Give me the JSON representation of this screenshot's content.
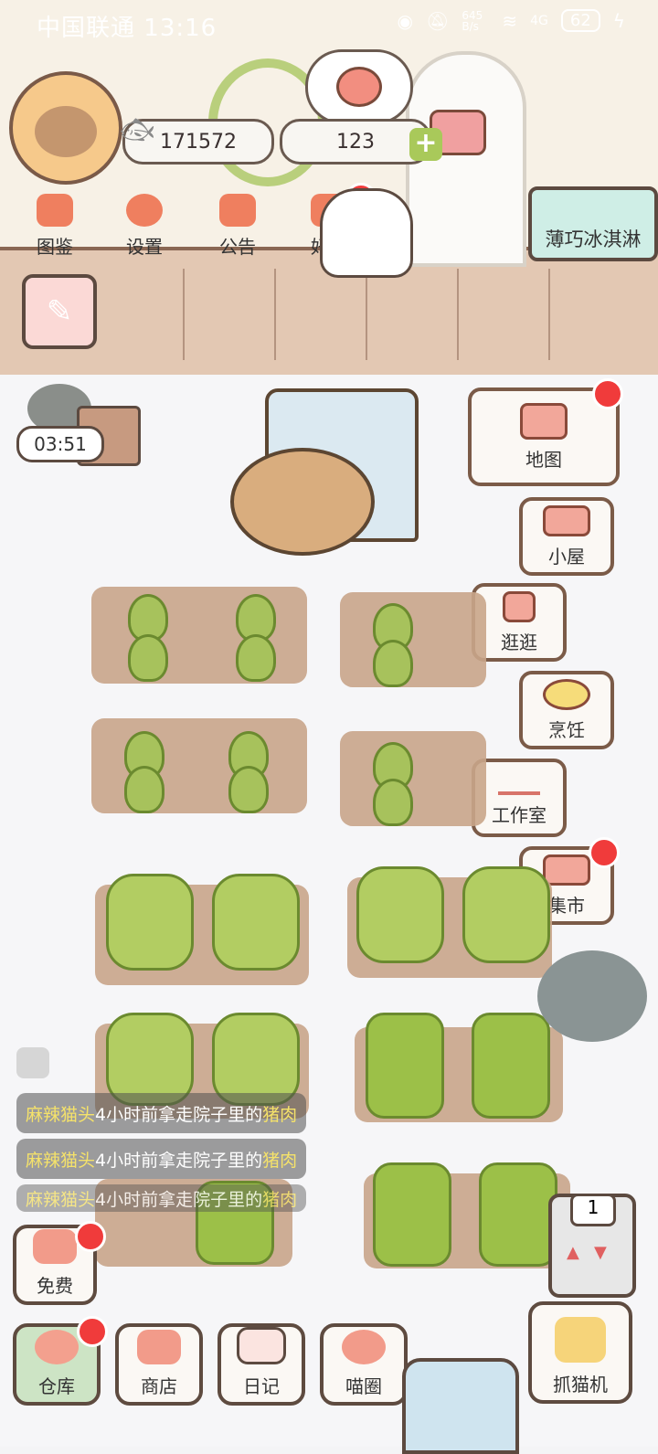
{
  "status_bar": {
    "carrier": "中国联通",
    "time": "13:16",
    "network": "4G",
    "speed": "645 B/s",
    "battery": "62"
  },
  "profile": {
    "coins": "171572",
    "hearts": "123"
  },
  "top_menu": [
    {
      "label": "图鉴"
    },
    {
      "label": "设置"
    },
    {
      "label": "公告"
    },
    {
      "label": "好友"
    }
  ],
  "event_banner": "薄巧冰淇淋",
  "timer": "03:51",
  "side_menu": [
    {
      "label": "地图"
    },
    {
      "label": "小屋"
    },
    {
      "label": "逛逛"
    },
    {
      "label": "烹饪"
    },
    {
      "label": "工作室"
    },
    {
      "label": "集市"
    }
  ],
  "feed": [
    {
      "who": "麻辣猫头",
      "text": "4小时前拿走院子里的",
      "item": "猪肉"
    },
    {
      "who": "麻辣猫头",
      "text": "4小时前拿走院子里的",
      "item": "猪肉"
    },
    {
      "who": "麻辣猫头",
      "text": "4小时前拿走院子里的",
      "item": "猪肉"
    }
  ],
  "free_label": "免费",
  "elevator_floor": "1",
  "bottom_dock": [
    {
      "label": "仓库"
    },
    {
      "label": "商店"
    },
    {
      "label": "日记"
    },
    {
      "label": "喵圈"
    }
  ],
  "claw_machine": "抓猫机",
  "colors": {
    "accent": "#ef7f5f",
    "badge": "#f03b3b",
    "plant": "#a7c25c",
    "soil": "#c9a58a"
  }
}
